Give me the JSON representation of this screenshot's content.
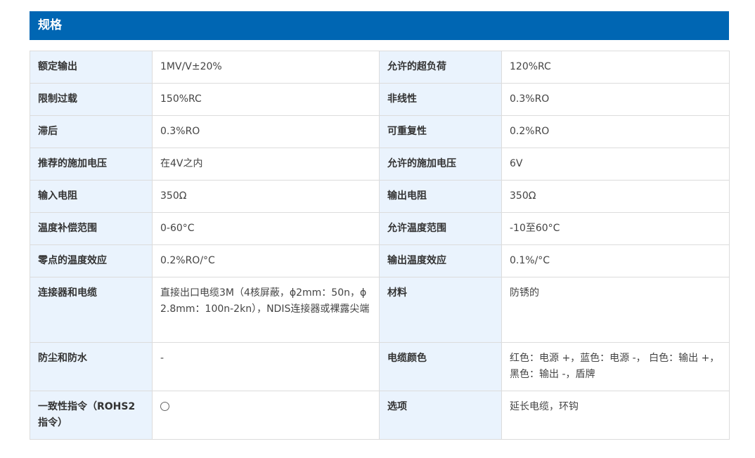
{
  "header": {
    "title": "规格"
  },
  "rows": [
    {
      "k1": "额定输出",
      "v1": "1MV/V±20%",
      "k2": "允许的超负荷",
      "v2": "120%RC"
    },
    {
      "k1": "限制过载",
      "v1": "150%RC",
      "k2": "非线性",
      "v2": "0.3%RO"
    },
    {
      "k1": "滞后",
      "v1": "0.3%RO",
      "k2": "可重复性",
      "v2": "0.2%RO"
    },
    {
      "k1": "推荐的施加电压",
      "v1": "在4V之内",
      "k2": "允许的施加电压",
      "v2": "6V"
    },
    {
      "k1": "输入电阻",
      "v1": "350Ω",
      "k2": "输出电阻",
      "v2": "350Ω"
    },
    {
      "k1": "温度补偿范围",
      "v1": "0-60°C",
      "k2": "允许温度范围",
      "v2": "-10至60°C"
    },
    {
      "k1": "零点的温度效应",
      "v1": "0.2%RO/°C",
      "k2": "输出温度效应",
      "v2": "0.1%/°C"
    },
    {
      "k1": "连接器和电缆",
      "v1": "直接出口电缆3M（4核屏蔽，ϕ2mm：50n，ϕ2.8mm：100n-2kn），NDIS连接器或裸露尖端",
      "k2": "材料",
      "v2": "防锈的"
    },
    {
      "k1": "防尘和防水",
      "v1": "-",
      "k2": "电缆颜色",
      "v2": "红色：电源 +，蓝色：电源 -， 白色：输出 +，黑色：输出 -，盾牌"
    },
    {
      "k1": "一致性指令（ROHS2指令）",
      "v1": "",
      "v1_icon": "circle-icon",
      "k2": "选项",
      "v2": "延长电缆，环钩"
    }
  ]
}
